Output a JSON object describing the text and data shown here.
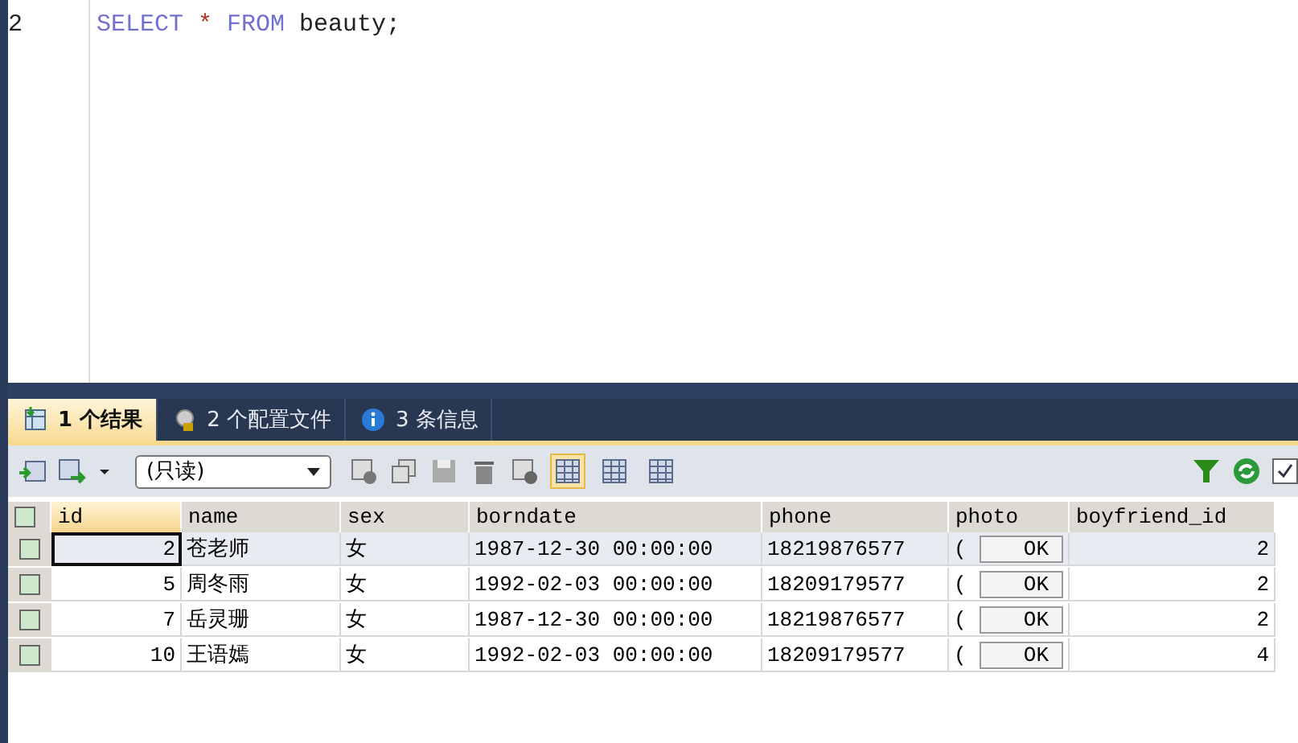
{
  "editor": {
    "lines": [
      {
        "number": "2",
        "tokens": [
          {
            "kind": "keyword",
            "text": "SELECT"
          },
          {
            "kind": "operator",
            "text": "*"
          },
          {
            "kind": "keyword",
            "text": "FROM"
          },
          {
            "kind": "plain",
            "text": "beauty;"
          }
        ]
      }
    ]
  },
  "tabs": [
    {
      "label": "1 个结果",
      "selected": true
    },
    {
      "label": "2 个配置文件",
      "selected": false
    },
    {
      "label": "3 条信息",
      "selected": false
    }
  ],
  "toolbar": {
    "mode_select": "(只读)",
    "view_buttons": [
      {
        "selected": true
      },
      {
        "selected": false
      },
      {
        "selected": false
      }
    ],
    "right_checkbox_checked": true
  },
  "table": {
    "header_checked": false,
    "columns": [
      "id",
      "name",
      "sex",
      "borndate",
      "phone",
      "photo",
      "boyfriend_id"
    ],
    "rows": [
      {
        "selected": true,
        "checked": false,
        "cells": [
          "2",
          "苍老师",
          "女",
          "1987-12-30 00:00:00",
          "18219876577",
          "(",
          "OK",
          "2"
        ]
      },
      {
        "selected": false,
        "checked": false,
        "cells": [
          "5",
          "周冬雨",
          "女",
          "1992-02-03 00:00:00",
          "18209179577",
          "(",
          "OK",
          "2"
        ]
      },
      {
        "selected": false,
        "checked": false,
        "cells": [
          "7",
          "岳灵珊",
          "女",
          "1987-12-30 00:00:00",
          "18219876577",
          "(",
          "OK",
          "2"
        ]
      },
      {
        "selected": false,
        "checked": false,
        "cells": [
          "10",
          "王语嫣",
          "女",
          "1992-02-03 00:00:00",
          "18209179577",
          "(",
          "OK",
          "4"
        ]
      }
    ]
  }
}
